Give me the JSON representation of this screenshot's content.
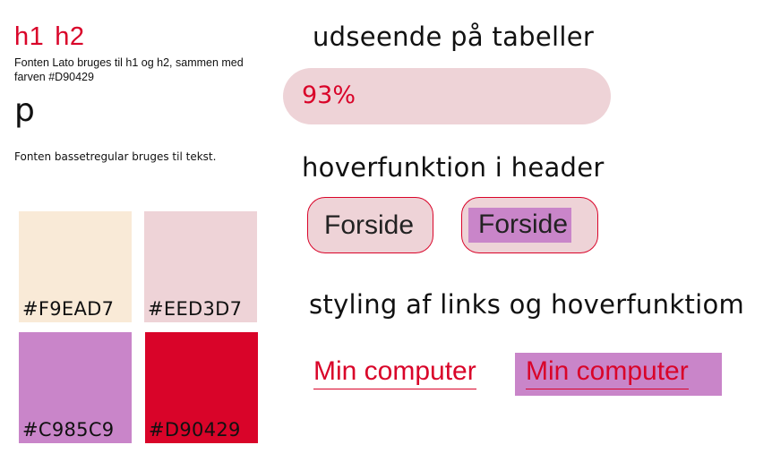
{
  "colors": {
    "red": "#D90429",
    "pink": "#EED3D7",
    "cream": "#F9EAD7",
    "purple": "#C985C9"
  },
  "fonts": {
    "h1_label": "h1",
    "h2_label": "h2",
    "lato_note": "Fonten Lato bruges til h1 og h2, sammen med farven #D90429",
    "p_label": "p",
    "basset_note": "Fonten bassetregular bruges til tekst."
  },
  "swatches": [
    {
      "hex": "#F9EAD7",
      "label": "#F9EAD7"
    },
    {
      "hex": "#EED3D7",
      "label": "#EED3D7"
    },
    {
      "hex": "#C985C9",
      "label": "#C985C9"
    },
    {
      "hex": "#D90429",
      "label": "#D90429"
    }
  ],
  "tables": {
    "heading": "udseende på tabeller",
    "value": "93%"
  },
  "header_hover": {
    "heading": "hoverfunktion i header",
    "normal_label": "Forside",
    "hover_label": "Forside"
  },
  "links": {
    "heading": "styling af links og hoverfunktiom",
    "normal_label": "Min computer",
    "hover_label": "Min computer"
  }
}
